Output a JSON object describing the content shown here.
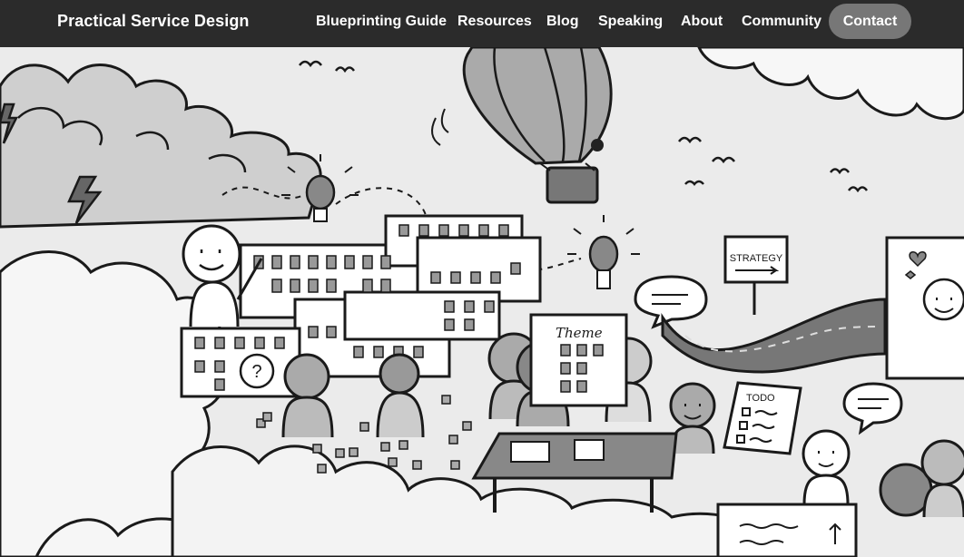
{
  "header": {
    "brand": "Practical Service Design",
    "nav": [
      {
        "label": "Blueprinting Guide"
      },
      {
        "label": "Resources"
      },
      {
        "label": "Blog"
      },
      {
        "label": "Speaking"
      },
      {
        "label": "About"
      },
      {
        "label": "Community"
      }
    ],
    "contact_label": "Contact"
  },
  "hero": {
    "sign_text": "STRATEGY",
    "theme_text": "Theme",
    "todo_text": "TODO",
    "question_mark": "?"
  },
  "colors": {
    "header_bg": "#2b2b2b",
    "contact_bg": "#777777",
    "nav_text": "#ffffff"
  }
}
